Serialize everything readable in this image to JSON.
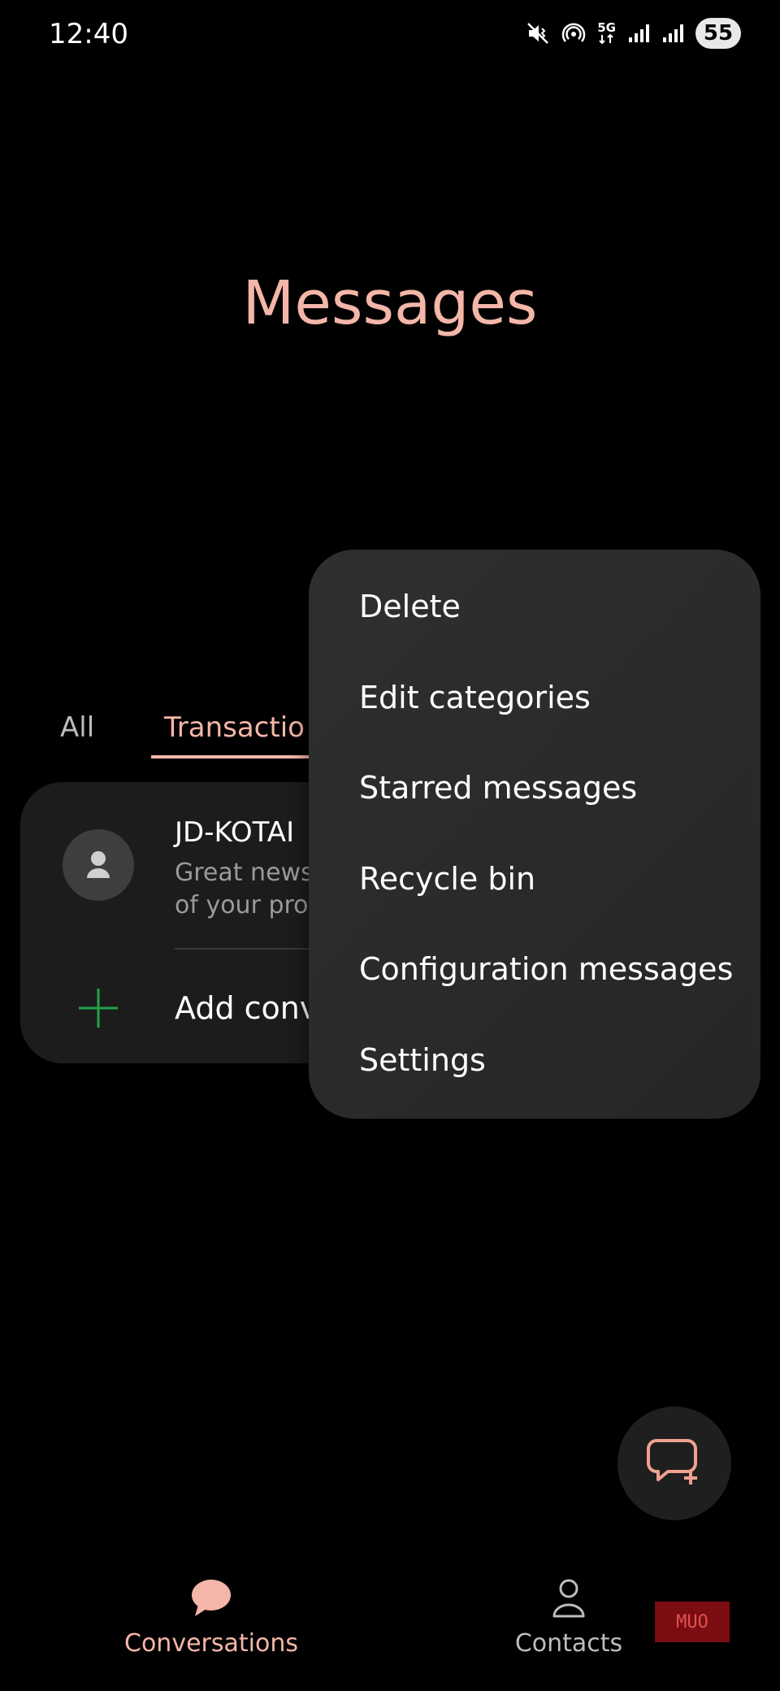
{
  "status_bar": {
    "time": "12:40",
    "network_label": "5G",
    "battery": "55",
    "icons": [
      "mute-vibrate-icon",
      "hotspot-icon",
      "5g-icon",
      "signal-icon",
      "signal-icon",
      "battery-icon"
    ]
  },
  "header": {
    "title": "Messages"
  },
  "tabs": [
    {
      "label": "All",
      "selected": false
    },
    {
      "label": "Transactio",
      "selected": true
    }
  ],
  "conversation": {
    "name": "JD-KOTAI",
    "preview_line1": "Great news",
    "preview_line2": "of your pro"
  },
  "add_conversation": {
    "label": "Add conv"
  },
  "menu": {
    "items": [
      {
        "label": "Delete"
      },
      {
        "label": "Edit categories"
      },
      {
        "label": "Starred messages"
      },
      {
        "label": "Recycle bin"
      },
      {
        "label": "Configuration messages"
      },
      {
        "label": "Settings"
      }
    ]
  },
  "fab": {
    "icon": "new-chat-icon"
  },
  "bottom_nav": {
    "items": [
      {
        "label": "Conversations",
        "icon": "chat-bubble-icon",
        "selected": true
      },
      {
        "label": "Contacts",
        "icon": "person-icon",
        "selected": false
      }
    ]
  },
  "watermark": {
    "text": "MUO"
  },
  "colors": {
    "accent": "#f4b6a8",
    "background": "#000000",
    "menu_bg": "#2b2b2b",
    "card_bg": "#1c1c1c",
    "add_green": "#1fa34a"
  }
}
